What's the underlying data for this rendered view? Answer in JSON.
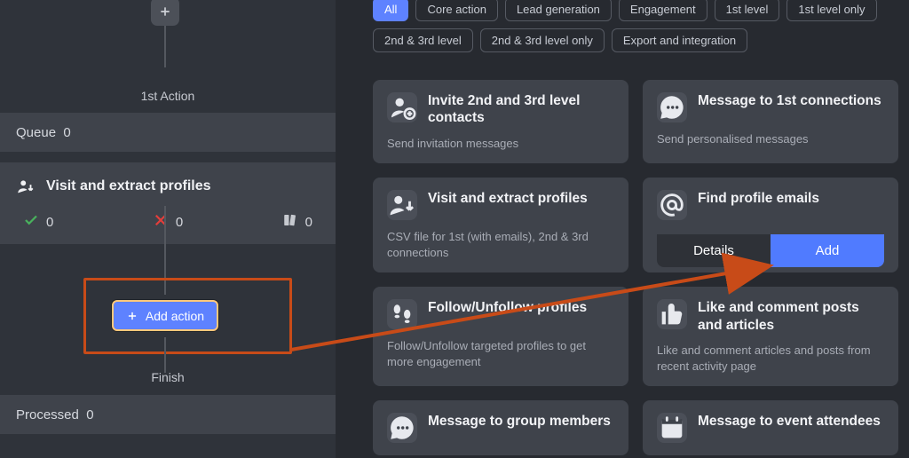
{
  "colors": {
    "accent": "#5e82ff",
    "highlight": "#c84b18",
    "success": "#49b15d",
    "error": "#e33e3b"
  },
  "workflow": {
    "first_action_label": "1st Action",
    "queue_label": "Queue",
    "queue_value": "0",
    "action_title": "Visit and extract profiles",
    "stats": {
      "success": "0",
      "fail": "0",
      "collected": "0"
    },
    "add_action_label": "Add action",
    "finish_label": "Finish",
    "processed_label": "Processed",
    "processed_value": "0"
  },
  "library": {
    "filters": [
      "All",
      "Core action",
      "Lead generation",
      "Engagement",
      "1st level",
      "1st level only",
      "2nd & 3rd level",
      "2nd & 3rd level only",
      "Export and integration"
    ],
    "active_filter": "All",
    "details_label": "Details",
    "add_label": "Add",
    "cards": [
      {
        "title": "Invite 2nd and 3rd level contacts",
        "subtitle": "Send invitation messages",
        "icon": "person-add"
      },
      {
        "title": "Message to 1st connections",
        "subtitle": "Send personalised messages",
        "icon": "chat"
      },
      {
        "title": "Visit and extract profiles",
        "subtitle": "CSV file for 1st (with emails), 2nd & 3rd connections",
        "icon": "download-person"
      },
      {
        "title": "Find profile emails",
        "subtitle": "",
        "icon": "at",
        "has_actions": true
      },
      {
        "title": "Follow/Unfollow profiles",
        "subtitle": "Follow/Unfollow targeted profiles to get more engagement",
        "icon": "footsteps"
      },
      {
        "title": "Like and comment posts and articles",
        "subtitle": "Like and comment articles and posts from recent activity page",
        "icon": "thumb"
      },
      {
        "title": "Message to group members",
        "subtitle": "",
        "icon": "chat"
      },
      {
        "title": "Message to event attendees",
        "subtitle": "",
        "icon": "event"
      }
    ]
  }
}
